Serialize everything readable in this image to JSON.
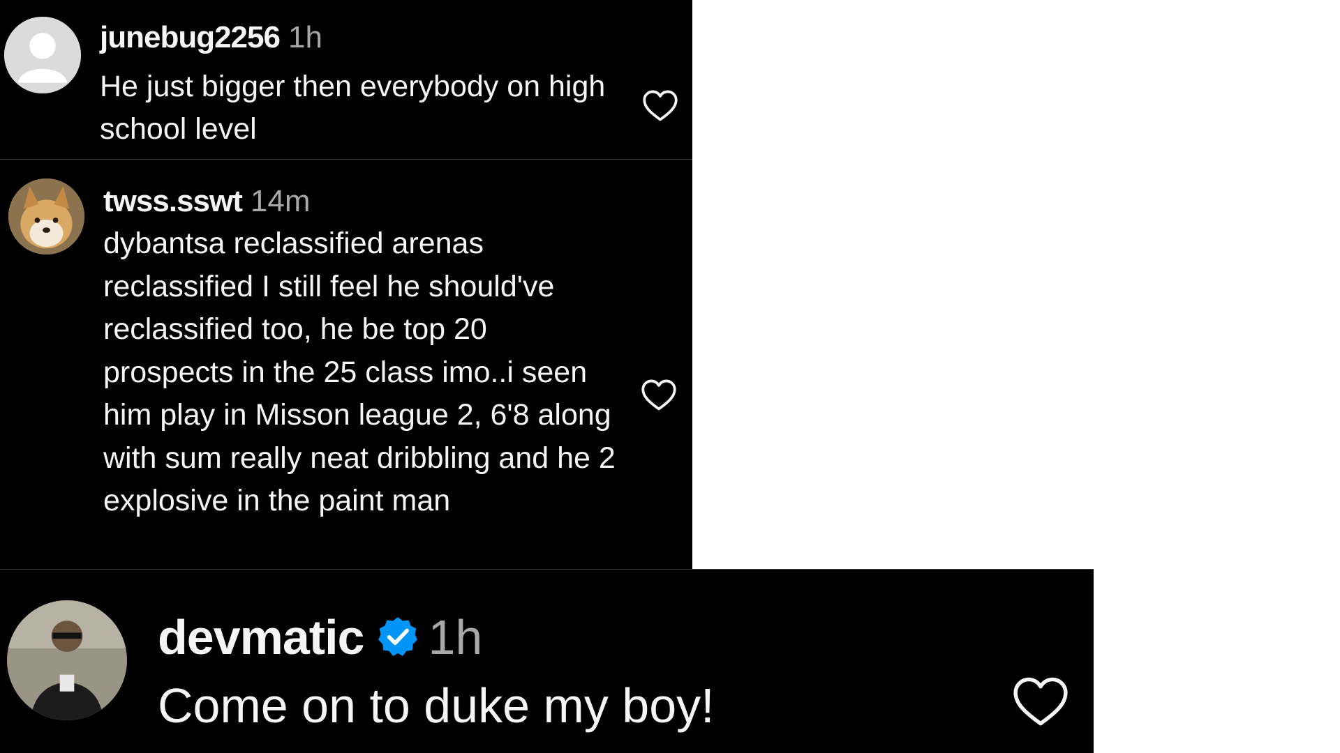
{
  "comments": [
    {
      "username": "junebug2256",
      "time": "1h",
      "text": "He just bigger then everybody on high school level",
      "verified": false,
      "avatar_icon": "default-avatar-icon",
      "like_icon": "heart-outline-icon"
    },
    {
      "username": "twss.sswt",
      "time": "14m",
      "text": "dybantsa reclassified arenas reclassified I still feel he should've reclassified too, he be top 20 prospects in the 25 class imo..i seen him play in Misson league 2, 6'8 along with sum really neat dribbling and he 2 explosive in the paint man",
      "verified": false,
      "avatar_icon": "dog-avatar",
      "like_icon": "heart-outline-icon"
    },
    {
      "username": "devmatic",
      "time": "1h",
      "text": "Come on to duke my boy!",
      "verified": true,
      "avatar_icon": "user-photo-avatar",
      "like_icon": "heart-outline-icon"
    }
  ],
  "colors": {
    "background": "#000000",
    "text": "#f5f5f5",
    "muted": "#a8a8a8",
    "verified": "#0095f6"
  }
}
